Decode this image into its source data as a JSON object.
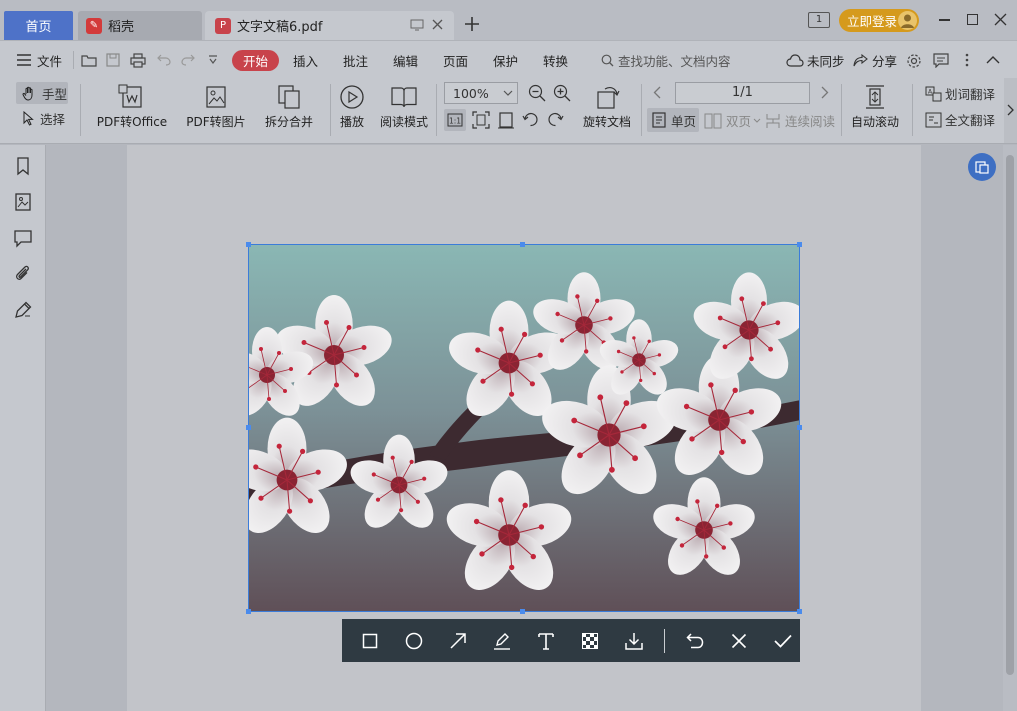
{
  "tabs": {
    "home": "首页",
    "daoke": "稻壳",
    "doc": "文字文稿6.pdf"
  },
  "titlebar": {
    "badge": "1",
    "login": "立即登录"
  },
  "menu": {
    "file": "文件",
    "start": "开始",
    "insert": "插入",
    "annotate": "批注",
    "edit": "编辑",
    "page": "页面",
    "protect": "保护",
    "convert": "转换",
    "search_placeholder": "查找功能、文档内容",
    "sync": "未同步",
    "share": "分享"
  },
  "toolbar": {
    "hand": "手型",
    "select": "选择",
    "pdf_to_office": "PDF转Office",
    "pdf_to_image": "PDF转图片",
    "split_merge": "拆分合并",
    "play": "播放",
    "read_mode": "阅读模式",
    "zoom": "100%",
    "rotate_doc": "旋转文档",
    "page_indicator": "1/1",
    "single_page": "单页",
    "double_page": "双页",
    "continuous": "连续阅读",
    "auto_scroll": "自动滚动",
    "word_translate": "划词翻译",
    "full_translate": "全文翻译"
  },
  "accent": "#4e72c8",
  "start_color": "#c8434b"
}
